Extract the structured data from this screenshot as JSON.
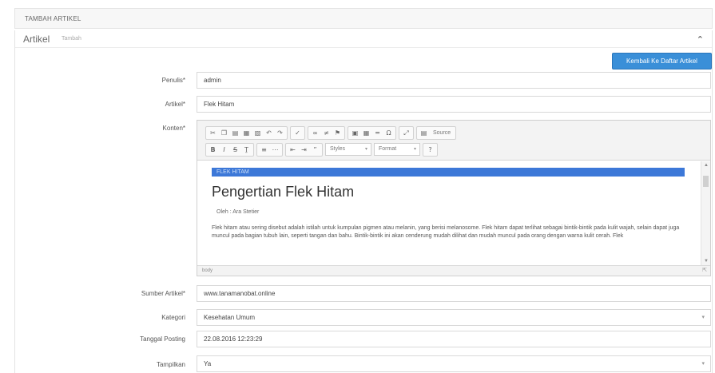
{
  "top_title": "TAMBAH ARTIKEL",
  "panel": {
    "title": "Artikel",
    "subtitle": "Tambah",
    "collapse_icon": "chevron-up-icon"
  },
  "back_button": "Kembali Ke Daftar Artikel",
  "form": {
    "penulis": {
      "label": "Penulis*",
      "value": "admin"
    },
    "artikel": {
      "label": "Artikel*",
      "value": "Flek Hitam"
    },
    "konten": {
      "label": "Konten*"
    },
    "sumber": {
      "label": "Sumber Artikel*",
      "value": "www.tanamanobat.online"
    },
    "kategori": {
      "label": "Kategori",
      "value": "Kesehatan Umum"
    },
    "tanggal": {
      "label": "Tanggal Posting",
      "value": "22.08.2016 12:23:29"
    },
    "tampilkan": {
      "label": "Tampilkan",
      "value": "Ya"
    }
  },
  "editor": {
    "toolbar": {
      "source_label": "Source",
      "styles": "Styles",
      "format": "Format",
      "help": "?"
    },
    "selected_line": "FLEK HITAM",
    "heading": "Pengertian Flek Hitam",
    "byline": "Oleh : Ara Stetier",
    "paragraph": "Flek hitam atau sering disebut adalah istilah untuk kumpulan pigmen atau melanin, yang berisi melanosome. Flek hitam dapat terlihat sebagai bintik-bintik pada kulit wajah, selain dapat juga muncul pada bagian tubuh lain, seperti tangan dan bahu. Bintik-bintik ini akan cenderung mudah dilihat dan mudah muncul pada orang dengan warna kulit cerah. Flek",
    "status_path": "body"
  },
  "colors": {
    "accent": "#3a8fd8",
    "selection": "#3c78d8"
  }
}
